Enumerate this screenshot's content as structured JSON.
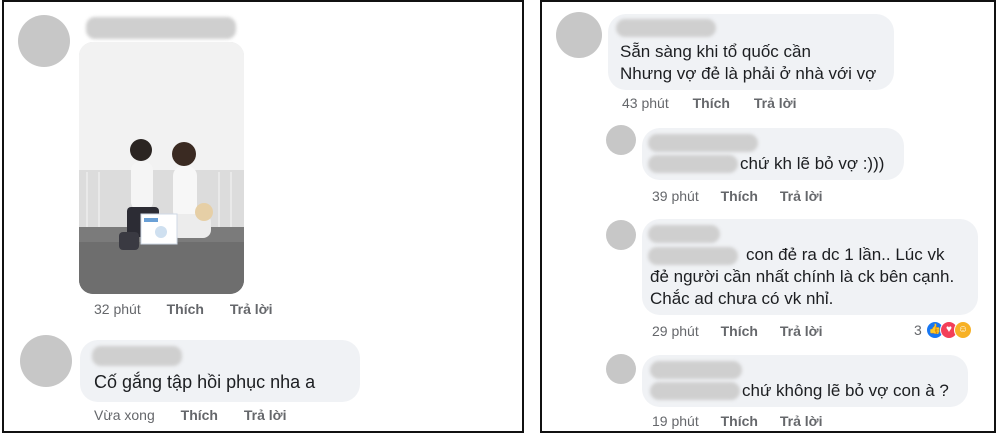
{
  "left": {
    "comment1": {
      "time": "32 phút",
      "like": "Thích",
      "reply": "Trả lời"
    },
    "comment2": {
      "text": "Cố gắng tập hồi phục nha a",
      "time": "Vừa xong",
      "like": "Thích",
      "reply": "Trả lời"
    }
  },
  "right": {
    "comment1": {
      "line1": "Sẵn sàng khi tổ quốc cần",
      "line2": "Nhưng vợ đẻ là phải ở nhà với vợ",
      "time": "43 phút",
      "like": "Thích",
      "reply": "Trả lời"
    },
    "reply1": {
      "text": "chứ kh lẽ bỏ vợ :)))",
      "time": "39 phút",
      "like": "Thích",
      "reply": "Trả lời"
    },
    "reply2": {
      "line1": "con đẻ ra dc 1 lần.. Lúc vk",
      "line2": "đẻ người cần nhất chính là ck bên cạnh.",
      "line3": "Chắc ad chưa có vk nhỉ.",
      "time": "29 phút",
      "like": "Thích",
      "reply": "Trả lời",
      "reaction_count": "3",
      "reaction_icons": [
        "like-icon",
        "love-icon",
        "care-icon"
      ]
    },
    "reply3": {
      "text": "chứ không lẽ bỏ vợ con à ?",
      "time": "19 phút",
      "like": "Thích",
      "reply": "Trả lời"
    }
  },
  "colors": {
    "bubble": "#f0f2f5",
    "meta": "#65676b",
    "like_blue": "#1877f2",
    "love_red": "#f33e58",
    "care_yellow": "#f7b125"
  }
}
